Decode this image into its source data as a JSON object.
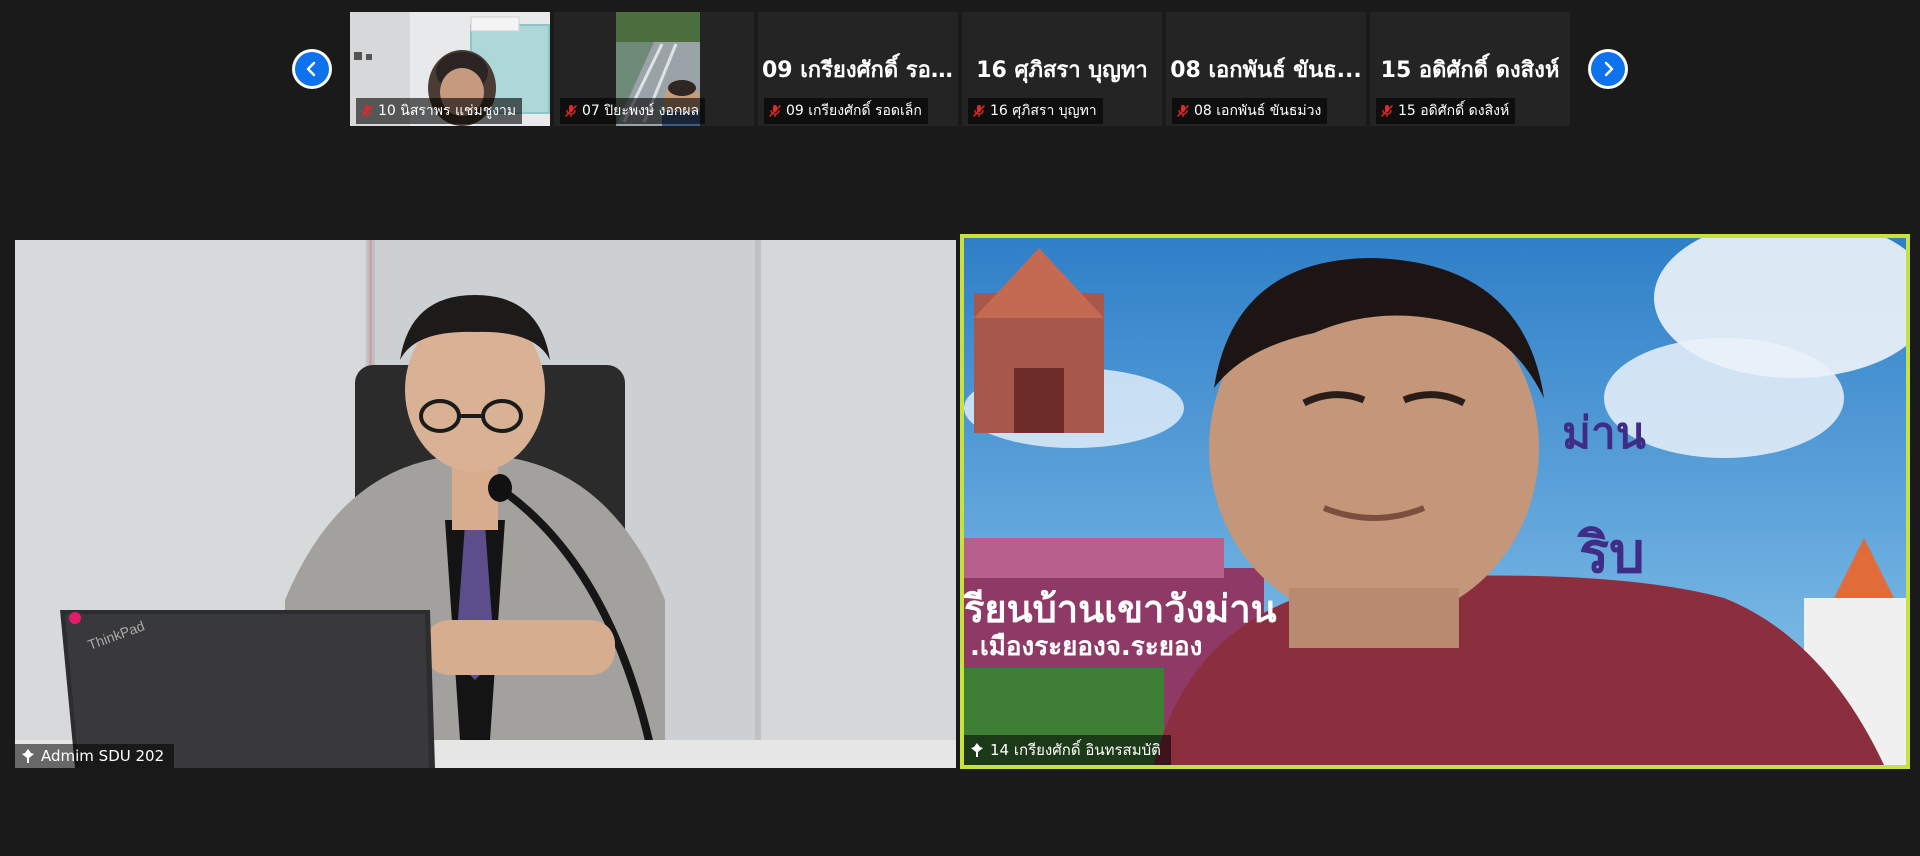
{
  "thumbnails": [
    {
      "label": "10 นิสราพร แช่มชูงาม",
      "video": true
    },
    {
      "label": "07 ปิยะพงษ์ งอกผล",
      "video": true
    },
    {
      "label": "09 เกรียงศักดิ์  รอดเล็ก",
      "title": "09 เกรียงศักดิ์  รอ...",
      "video": false
    },
    {
      "label": "16 ศุภิสรา บุญทา",
      "title": "16 ศุภิสรา บุญทา",
      "video": false
    },
    {
      "label": "08 เอกพันธ์ ขันธม่วง",
      "title": "08 เอกพันธ์ ขันธ...",
      "video": false
    },
    {
      "label": "15 อดิศักดิ์  ดงสิงห์",
      "title": "15 อดิศักดิ์  ดงสิงห์",
      "video": false
    }
  ],
  "main_left": {
    "name": "Admim SDU 202"
  },
  "main_right": {
    "name": "14 เกรียงศักดิ์  อินทรสมบัติ",
    "background_text": {
      "line1": "ม่าน",
      "line2": "ริบ",
      "wall1": "รียนบ้านเขาวังม่าน",
      "wall2": ".เมืองระยองจ.ระยอง"
    }
  },
  "colors": {
    "active_border": "#c7e23a",
    "nav_blue": "#0e72ed",
    "mic_off_red": "#e02828"
  },
  "icons": {
    "prev": "chevron-left-icon",
    "next": "chevron-right-icon",
    "muted": "mic-off-icon"
  }
}
